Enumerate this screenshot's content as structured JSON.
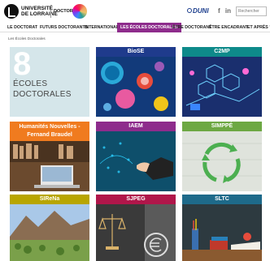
{
  "header": {
    "university_line1": "UNIVERSITÉ",
    "university_line2": "DE LORRAINE",
    "doctorat": "DOCTORAT",
    "brand": "DUNI",
    "social_f": "f",
    "social_in": "in",
    "search_placeholder": "Rechercher"
  },
  "nav": {
    "items": [
      {
        "label": "LE DOCTORAT"
      },
      {
        "label": "FUTURS DOCTORANTS"
      },
      {
        "label": "INTERNATIONAL"
      },
      {
        "label": "LES ÉCOLES DOCTORALES"
      },
      {
        "label": "ÊTRE DOCTORANT"
      },
      {
        "label": "ÊTRE ENCADRANT"
      },
      {
        "label": "ET APRÈS ?"
      }
    ]
  },
  "breadcrumb": "Les Écoles Doctorales",
  "intro": {
    "number": "8",
    "line1": "ÉCOLES",
    "line2": "DOCTORALES"
  },
  "tiles": [
    {
      "title": "BioSE",
      "color": "#1f3b8c"
    },
    {
      "title": "C2MP",
      "color": "#0e8a8a"
    },
    {
      "title": "Humanités Nouvelles - Fernand Braudel",
      "color": "#f07b1f"
    },
    {
      "title": "IAEM",
      "color": "#8e2c8c"
    },
    {
      "title": "SIMPPÉ",
      "color": "#6da843"
    },
    {
      "title": "SIReNa",
      "color": "#b8a500"
    },
    {
      "title": "SJPEG",
      "color": "#b0164a"
    },
    {
      "title": "SLTC",
      "color": "#1e6a8a"
    }
  ],
  "colors": {
    "active_nav": "#8e2c8c",
    "intro_bg": "#d5e6ea"
  }
}
